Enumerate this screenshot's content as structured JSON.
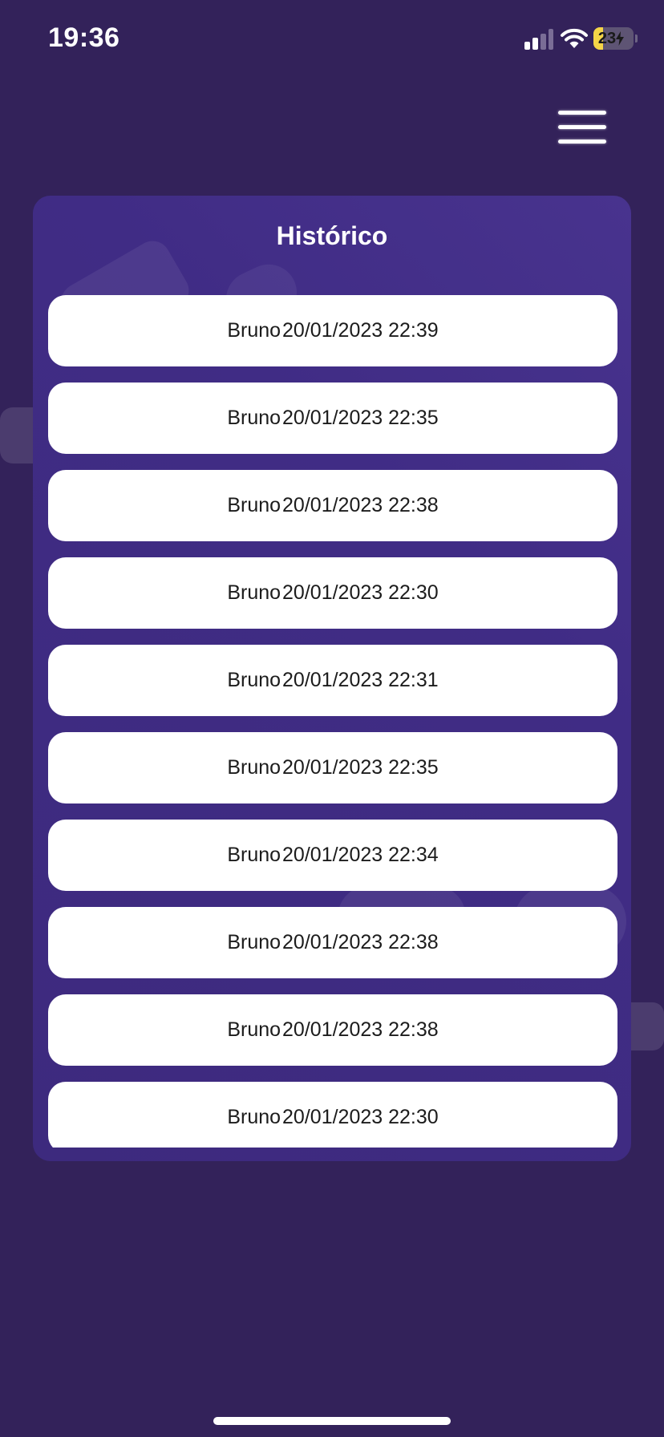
{
  "status_bar": {
    "time": "19:36",
    "battery_level": "23",
    "battery_fraction": 0.23,
    "signal_icon": "signal-bars-icon",
    "wifi_icon": "wifi-icon",
    "charging_icon": "charging-bolt-icon"
  },
  "menu": {
    "icon": "hamburger-menu-icon"
  },
  "colors": {
    "background": "#33225a",
    "card": "#402c85",
    "item_background": "#ffffff",
    "battery_fill": "#f5d547"
  },
  "history": {
    "title": "Histórico",
    "items": [
      {
        "name": "Bruno",
        "datetime": "20/01/2023 22:39"
      },
      {
        "name": "Bruno",
        "datetime": "20/01/2023 22:35"
      },
      {
        "name": "Bruno",
        "datetime": "20/01/2023 22:38"
      },
      {
        "name": "Bruno",
        "datetime": "20/01/2023 22:30"
      },
      {
        "name": "Bruno",
        "datetime": "20/01/2023 22:31"
      },
      {
        "name": "Bruno",
        "datetime": "20/01/2023 22:35"
      },
      {
        "name": "Bruno",
        "datetime": "20/01/2023 22:34"
      },
      {
        "name": "Bruno",
        "datetime": "20/01/2023 22:38"
      },
      {
        "name": "Bruno",
        "datetime": "20/01/2023 22:38"
      },
      {
        "name": "Bruno",
        "datetime": "20/01/2023 22:30"
      }
    ]
  }
}
